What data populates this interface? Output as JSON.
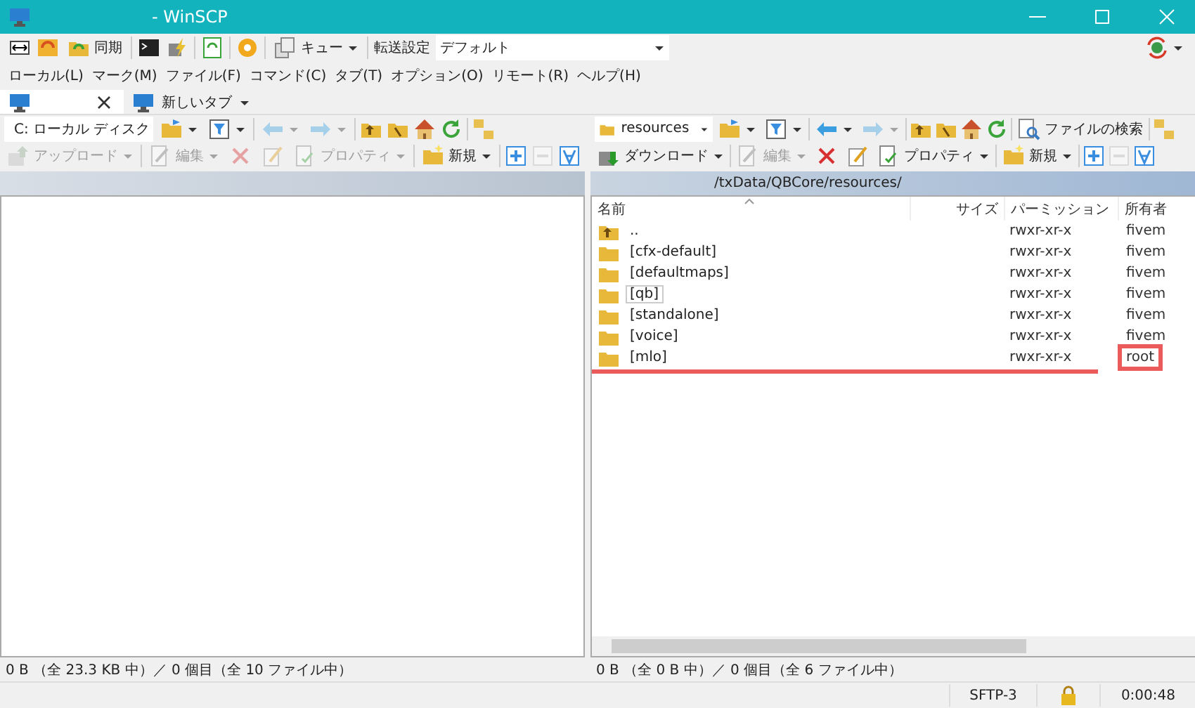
{
  "window": {
    "title": "- WinSCP"
  },
  "main_toolbar": {
    "sync_label": "同期",
    "queue_label": "キュー",
    "transfer_label": "転送設定",
    "transfer_preset": "デフォルト"
  },
  "menu": [
    "ローカル(L)",
    "マーク(M)",
    "ファイル(F)",
    "コマンド(C)",
    "タブ(T)",
    "オプション(O)",
    "リモート(R)",
    "ヘルプ(H)"
  ],
  "tabs": [
    {
      "kind": "session",
      "selected": true
    },
    {
      "kind": "new",
      "label": "新しいタブ",
      "selected": false
    }
  ],
  "local_panel": {
    "drive": "C: ローカル ディスク",
    "nav": [
      {
        "kind": "back",
        "disabled": true
      },
      {
        "kind": "forward",
        "disabled": true
      }
    ],
    "toolbar": [
      {
        "kind": "upload",
        "label": "アップロード",
        "disabled": true
      },
      {
        "kind": "edit",
        "label": "編集",
        "disabled": true
      },
      {
        "kind": "delete",
        "disabled": true
      },
      {
        "kind": "rename",
        "disabled": true
      },
      {
        "kind": "properties",
        "label": "プロパティ",
        "disabled": true
      },
      {
        "kind": "new",
        "label": "新規",
        "disabled": false
      }
    ],
    "status": "0 B （全 23.3 KB 中）／ 0 個目（全 10 ファイル中）"
  },
  "remote_panel": {
    "folder": "resources",
    "find_label": "ファイルの検索",
    "nav": [
      {
        "kind": "back",
        "disabled": false
      },
      {
        "kind": "forward",
        "disabled": true
      }
    ],
    "toolbar": [
      {
        "kind": "download",
        "label": "ダウンロード",
        "disabled": false
      },
      {
        "kind": "edit",
        "label": "編集",
        "disabled": true
      },
      {
        "kind": "delete",
        "disabled": false
      },
      {
        "kind": "rename",
        "disabled": false
      },
      {
        "kind": "properties",
        "label": "プロパティ",
        "disabled": false
      },
      {
        "kind": "new",
        "label": "新規",
        "disabled": false
      }
    ],
    "path": "/txData/QBCore/resources/",
    "columns": [
      "名前",
      "サイズ",
      "パーミッション",
      "所有者"
    ],
    "rows": [
      {
        "kind": "parent",
        "name": "..",
        "permissions": "rwxr-xr-x",
        "owner": "fivem",
        "focused": false,
        "highlighted": false
      },
      {
        "kind": "folder",
        "name": "[cfx-default]",
        "permissions": "rwxr-xr-x",
        "owner": "fivem",
        "focused": false,
        "highlighted": false
      },
      {
        "kind": "folder",
        "name": "[defaultmaps]",
        "permissions": "rwxr-xr-x",
        "owner": "fivem",
        "focused": false,
        "highlighted": false
      },
      {
        "kind": "folder",
        "name": "[qb]",
        "permissions": "rwxr-xr-x",
        "owner": "fivem",
        "focused": true,
        "highlighted": false
      },
      {
        "kind": "folder",
        "name": "[standalone]",
        "permissions": "rwxr-xr-x",
        "owner": "fivem",
        "focused": false,
        "highlighted": false
      },
      {
        "kind": "folder",
        "name": "[voice]",
        "permissions": "rwxr-xr-x",
        "owner": "fivem",
        "focused": false,
        "highlighted": false
      },
      {
        "kind": "folder",
        "name": "[mlo]",
        "permissions": "rwxr-xr-x",
        "owner": "root",
        "focused": false,
        "highlighted": true
      }
    ],
    "status": "0 B （全 0 B 中）／ 0 個目（全 6 ファイル中）"
  },
  "status_bar": {
    "protocol": "SFTP-3",
    "elapsed": "0:00:48"
  }
}
